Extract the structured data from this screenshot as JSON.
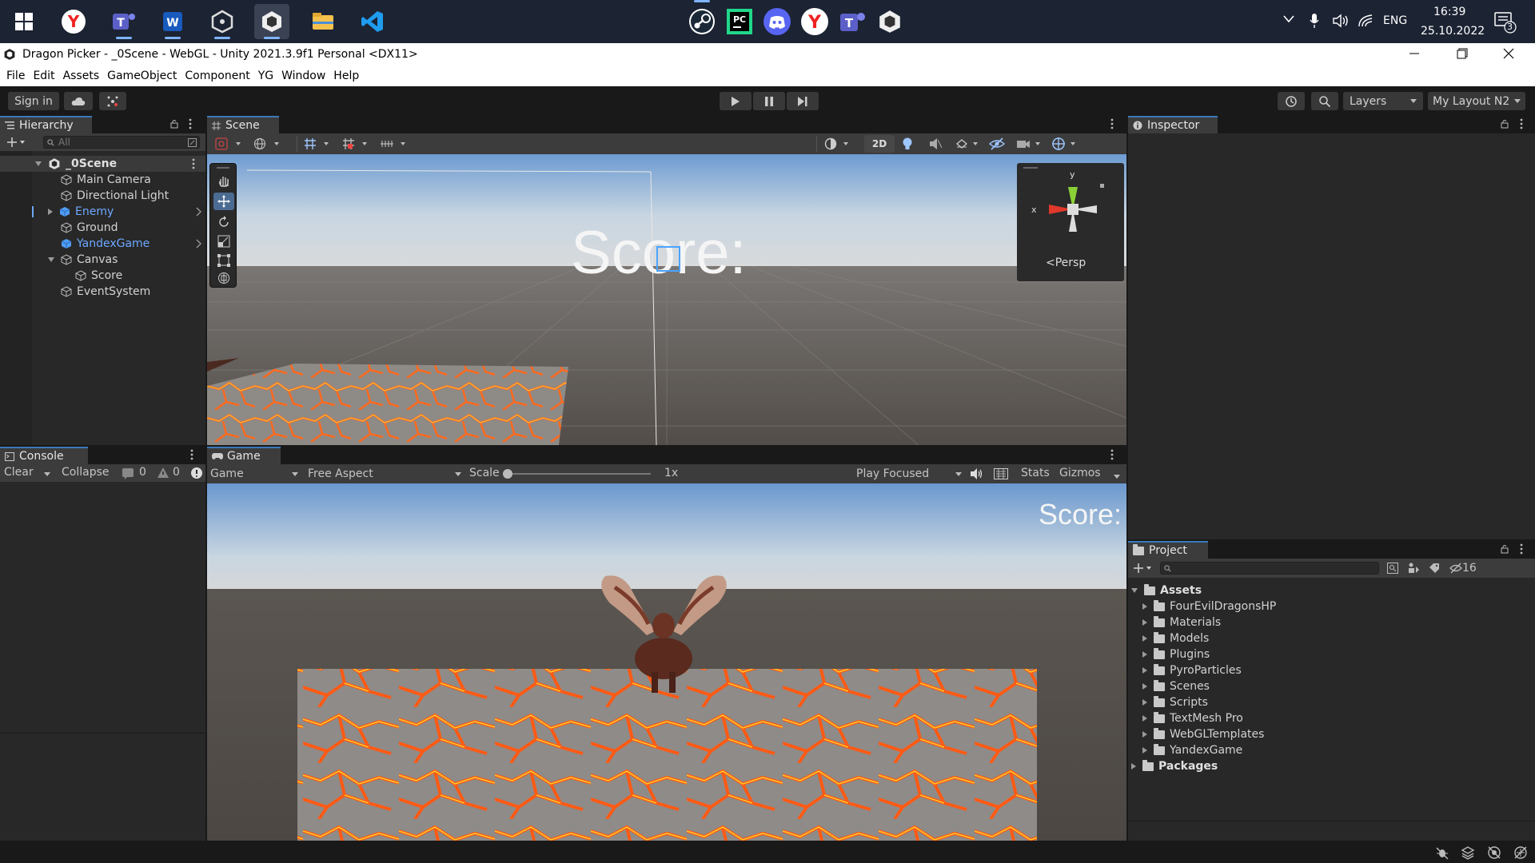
{
  "taskbar": {
    "apps": [
      "start-icon",
      "yandex-browser-icon",
      "teams-icon",
      "word-icon",
      "unity-hub-icon",
      "unity-editor-icon",
      "file-explorer-icon",
      "vscode-icon",
      "steam-icon",
      "pycharm-icon",
      "discord-icon",
      "yandex-browser-icon",
      "teams-icon",
      "unity-icon"
    ],
    "language": "ENG",
    "time": "16:39",
    "date": "25.10.2022",
    "notification_count": "3"
  },
  "window": {
    "title": "Dragon Picker - _0Scene - WebGL - Unity 2021.3.9f1 Personal <DX11>"
  },
  "menu": [
    "File",
    "Edit",
    "Assets",
    "GameObject",
    "Component",
    "YG",
    "Window",
    "Help"
  ],
  "toolbar": {
    "sign_in": "Sign in",
    "layers": "Layers",
    "layout": "My Layout N2"
  },
  "hierarchy": {
    "tab": "Hierarchy",
    "search_placeholder": "All",
    "scene": "_0Scene",
    "items": [
      {
        "label": "Main Camera",
        "color": "#d2d2d2"
      },
      {
        "label": "Directional Light",
        "color": "#d2d2d2"
      },
      {
        "label": "Enemy",
        "color": "#6ea8ff"
      },
      {
        "label": "Ground",
        "color": "#d2d2d2"
      },
      {
        "label": "YandexGame",
        "color": "#6ea8ff"
      },
      {
        "label": "Canvas",
        "color": "#d2d2d2"
      },
      {
        "label": "Score",
        "color": "#d2d2d2"
      },
      {
        "label": "EventSystem",
        "color": "#d2d2d2"
      }
    ]
  },
  "scene": {
    "tab": "Scene",
    "mode_2d": "2D",
    "score_text": "Score:",
    "gizmo_y": "y",
    "gizmo_x": "x",
    "persp": "Persp"
  },
  "console": {
    "tab": "Console",
    "clear": "Clear",
    "collapse": "Collapse",
    "warn_count": "0",
    "error_count": "0"
  },
  "game": {
    "tab": "Game",
    "display": "Game",
    "aspect": "Free Aspect",
    "scale_label": "Scale",
    "scale_value": "1x",
    "play_mode": "Play Focused",
    "stats": "Stats",
    "gizmos": "Gizmos",
    "score_text": "Score:"
  },
  "inspector": {
    "tab": "Inspector"
  },
  "project": {
    "tab": "Project",
    "hidden_count": "16",
    "root": "Assets",
    "folders": [
      "FourEvilDragonsHP",
      "Materials",
      "Models",
      "Plugins",
      "PyroParticles",
      "Scenes",
      "Scripts",
      "TextMesh Pro",
      "WebGLTemplates",
      "YandexGame"
    ],
    "packages": "Packages"
  },
  "colors": {
    "accent": "#3a79bb",
    "selection_blue": "#6ea8ff",
    "editor_bg": "#282828"
  }
}
